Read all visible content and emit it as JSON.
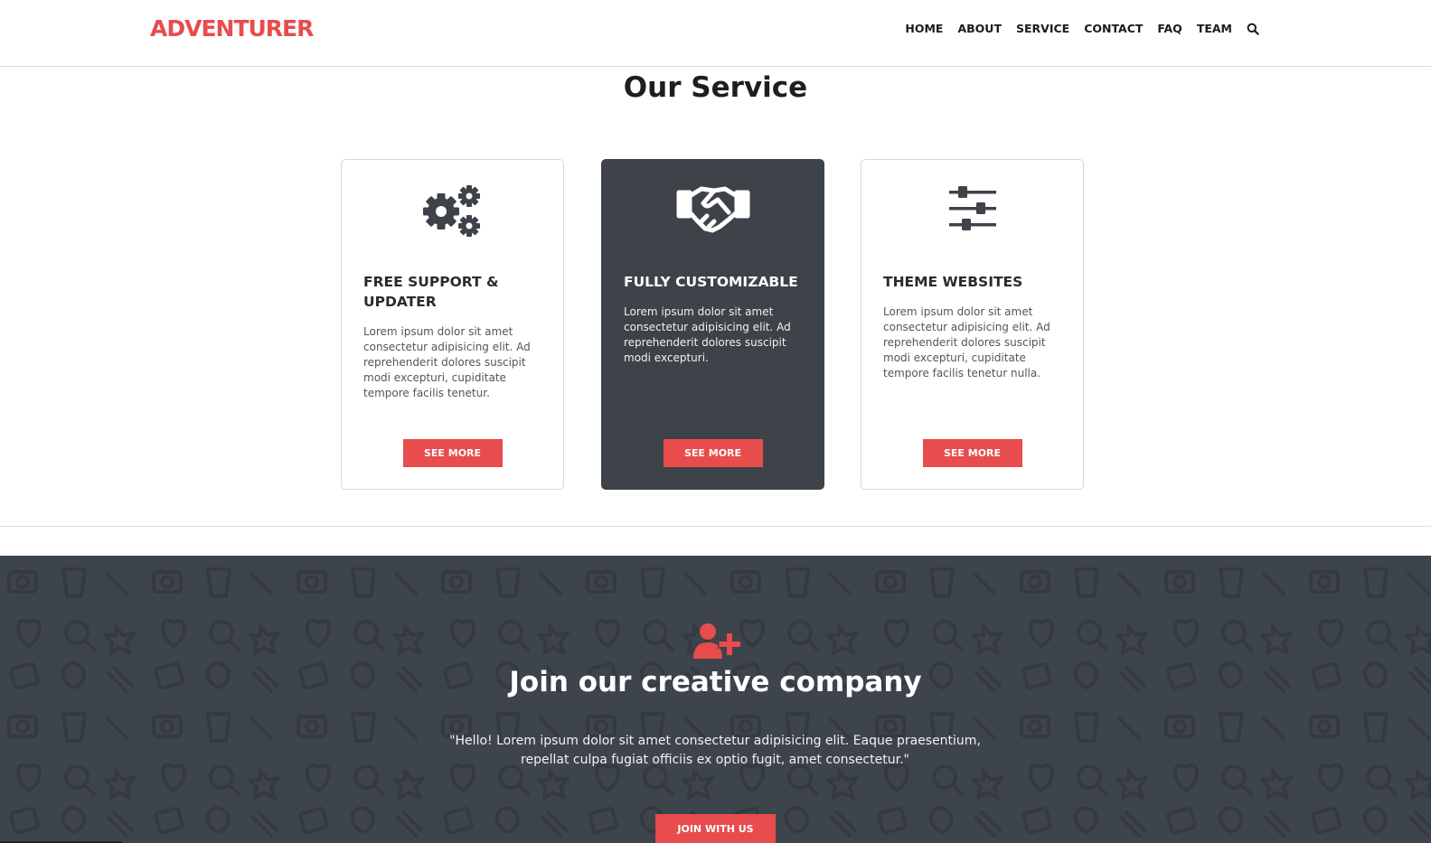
{
  "header": {
    "logo": "ADVENTURER",
    "nav": [
      "HOME",
      "ABOUT",
      "SERVICE",
      "CONTACT",
      "FAQ",
      "TEAM"
    ],
    "search_icon": "search-icon"
  },
  "service": {
    "title": "Our Service",
    "cards": [
      {
        "icon": "gears-icon",
        "title": "FREE SUPPORT & UPDATER",
        "text": "Lorem ipsum dolor sit amet consectetur adipisicing elit. Ad reprehenderit dolores suscipit modi excepturi, cupiditate tempore facilis tenetur.",
        "button": "SEE MORE"
      },
      {
        "icon": "handshake-icon",
        "title": "FULLY CUSTOMIZABLE",
        "text": "Lorem ipsum dolor sit amet consectetur adipisicing elit. Ad reprehenderit dolores suscipit modi excepturi.",
        "button": "SEE MORE"
      },
      {
        "icon": "sliders-icon",
        "title": "THEME WEBSITES",
        "text": "Lorem ipsum dolor sit amet consectetur adipisicing elit. Ad reprehenderit dolores suscipit modi excepturi, cupiditate tempore facilis tenetur nulla.",
        "button": "SEE MORE"
      }
    ]
  },
  "join": {
    "icon": "user-plus-icon",
    "title": "Join our creative company",
    "text": "\"Hello! Lorem ipsum dolor sit amet consectetur adipisicing elit. Eaque praesentium, repellat culpa fugiat officiis ex optio fugit, amet consectetur.\"",
    "button": "JOIN WITH US"
  },
  "colors": {
    "accent": "#e84c4c",
    "dark": "#3e4249",
    "join_bg": "#3e444c"
  }
}
